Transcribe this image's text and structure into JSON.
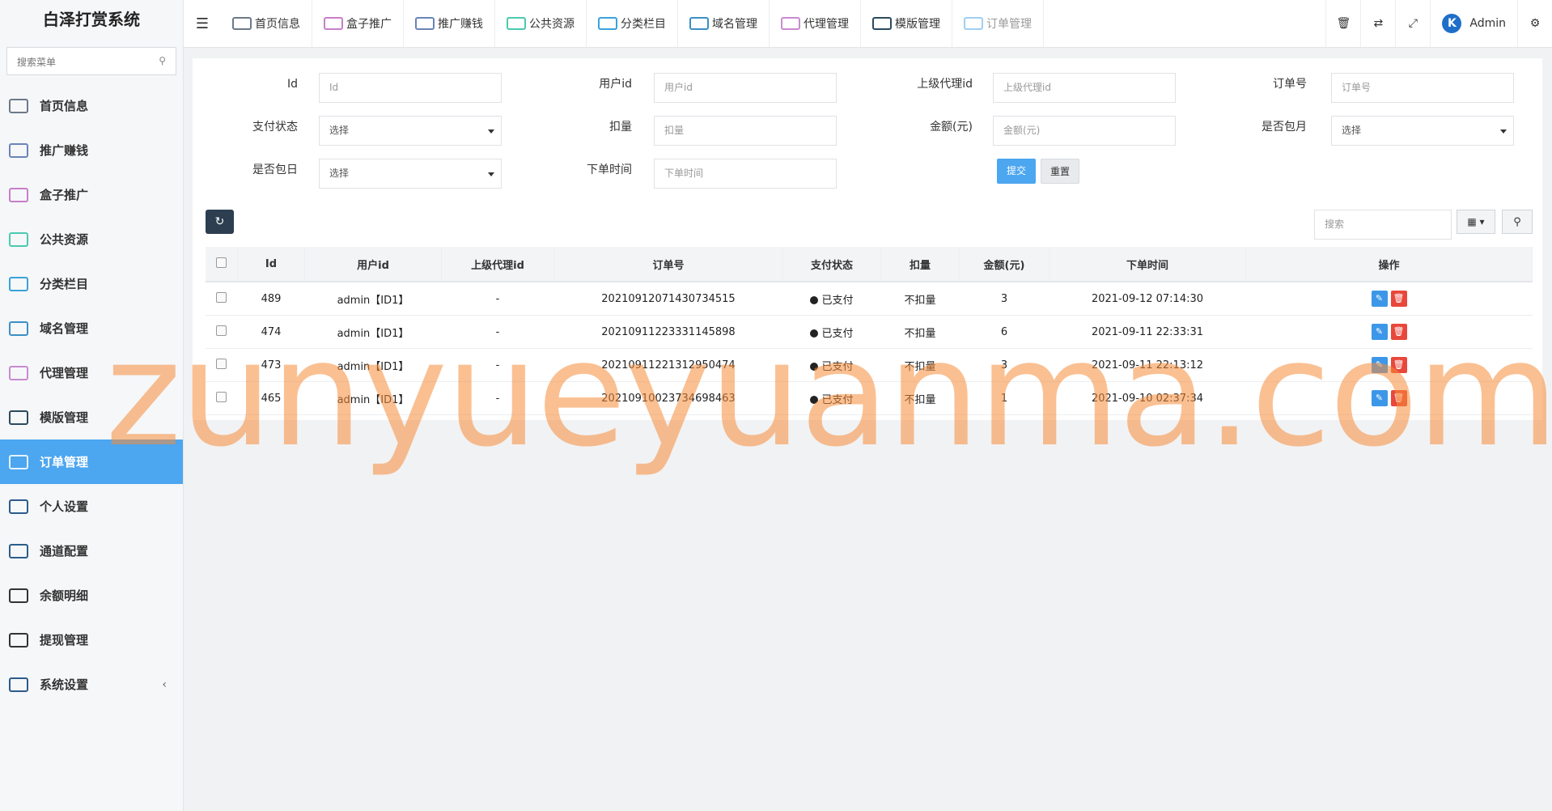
{
  "app": {
    "title": "白泽打赏系统"
  },
  "sidebar": {
    "search_placeholder": "搜索菜单",
    "items": [
      {
        "label": "首页信息",
        "icon": "monitor-icon",
        "color": "#6c7a89"
      },
      {
        "label": "推广赚钱",
        "icon": "megaphone-icon",
        "color": "#6a85b8"
      },
      {
        "label": "盒子推广",
        "icon": "box-icon",
        "color": "#c77fc9"
      },
      {
        "label": "公共资源",
        "icon": "network-icon",
        "color": "#4cc9b0"
      },
      {
        "label": "分类栏目",
        "icon": "sort-icon",
        "color": "#3aa3d9"
      },
      {
        "label": "域名管理",
        "icon": "window-icon",
        "color": "#3c8fc4"
      },
      {
        "label": "代理管理",
        "icon": "cart-icon",
        "color": "#c98bd0"
      },
      {
        "label": "模版管理",
        "icon": "template-icon",
        "color": "#2b4a5e"
      },
      {
        "label": "订单管理",
        "icon": "order-icon",
        "color": "#9ecff3"
      },
      {
        "label": "个人设置",
        "icon": "settings-window-icon",
        "color": "#2d5b8a"
      },
      {
        "label": "通道配置",
        "icon": "channel-icon",
        "color": "#2b5e8a"
      },
      {
        "label": "余额明细",
        "icon": "clipboard-icon",
        "color": "#333333"
      },
      {
        "label": "提现管理",
        "icon": "clipboard-icon",
        "color": "#333333"
      },
      {
        "label": "系统设置",
        "icon": "system-icon",
        "color": "#2d5b8a"
      }
    ],
    "active_index": 8,
    "collapse_arrow": "‹"
  },
  "topbar": {
    "tabs": [
      {
        "label": "首页信息",
        "icon": "monitor-icon",
        "color": "#6c7a89"
      },
      {
        "label": "盒子推广",
        "icon": "box-icon",
        "color": "#c77fc9"
      },
      {
        "label": "推广赚钱",
        "icon": "megaphone-icon",
        "color": "#6a85b8"
      },
      {
        "label": "公共资源",
        "icon": "network-icon",
        "color": "#4cc9b0"
      },
      {
        "label": "分类栏目",
        "icon": "sort-icon",
        "color": "#3aa3d9"
      },
      {
        "label": "域名管理",
        "icon": "window-icon",
        "color": "#3c8fc4"
      },
      {
        "label": "代理管理",
        "icon": "cart-icon",
        "color": "#c98bd0"
      },
      {
        "label": "模版管理",
        "icon": "template-icon",
        "color": "#2b4a5e"
      },
      {
        "label": "订单管理",
        "icon": "order-icon",
        "color": "#9ecff3"
      }
    ],
    "active_tab": 8,
    "user": {
      "name": "Admin",
      "avatar_letter": "K"
    }
  },
  "filters": {
    "id": {
      "label": "Id",
      "placeholder": "Id"
    },
    "user_id": {
      "label": "用户id",
      "placeholder": "用户id"
    },
    "parent_agent_id": {
      "label": "上级代理id",
      "placeholder": "上级代理id"
    },
    "order_no": {
      "label": "订单号",
      "placeholder": "订单号"
    },
    "pay_status": {
      "label": "支付状态",
      "value": "选择"
    },
    "deduct": {
      "label": "扣量",
      "placeholder": "扣量"
    },
    "amount": {
      "label": "金额(元)",
      "placeholder": "金额(元)"
    },
    "monthly": {
      "label": "是否包月",
      "value": "选择"
    },
    "daily": {
      "label": "是否包日",
      "value": "选择"
    },
    "order_time": {
      "label": "下单时间",
      "placeholder": "下单时间"
    },
    "submit_label": "提交",
    "reset_label": "重置"
  },
  "table": {
    "search_placeholder": "搜索",
    "columns": [
      "Id",
      "用户id",
      "上级代理id",
      "订单号",
      "支付状态",
      "扣量",
      "金额(元)",
      "下单时间",
      "操作"
    ],
    "rows": [
      {
        "id": "489",
        "user": "admin【ID1】",
        "agent": "-",
        "order_no": "20210912071430734515",
        "status": "已支付",
        "deduct": "不扣量",
        "amount": "3",
        "time": "2021-09-12 07:14:30"
      },
      {
        "id": "474",
        "user": "admin【ID1】",
        "agent": "-",
        "order_no": "20210911223331145898",
        "status": "已支付",
        "deduct": "不扣量",
        "amount": "6",
        "time": "2021-09-11 22:33:31"
      },
      {
        "id": "473",
        "user": "admin【ID1】",
        "agent": "-",
        "order_no": "20210911221312950474",
        "status": "已支付",
        "deduct": "不扣量",
        "amount": "3",
        "time": "2021-09-11 22:13:12"
      },
      {
        "id": "465",
        "user": "admin【ID1】",
        "agent": "-",
        "order_no": "20210910023734698463",
        "status": "已支付",
        "deduct": "不扣量",
        "amount": "1",
        "time": "2021-09-10 02:37:34"
      }
    ]
  },
  "watermark": "zunyueyuanma.com"
}
